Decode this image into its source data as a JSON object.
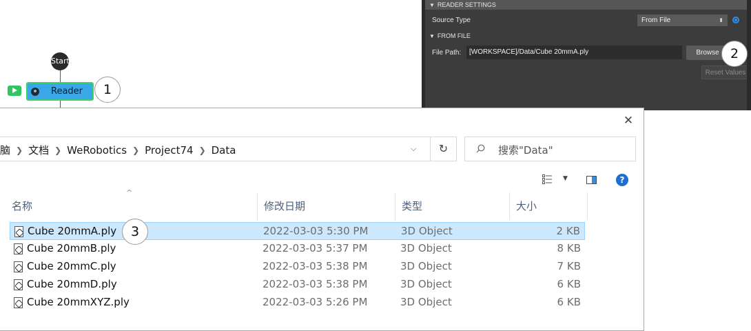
{
  "flow": {
    "start_label": "Start",
    "reader_label": "Reader"
  },
  "callouts": [
    "1",
    "2",
    "3"
  ],
  "panel": {
    "reader_settings_header": "READER SETTINGS",
    "source_type_label": "Source Type",
    "source_type_value": "From File",
    "from_file_header": "FROM FILE",
    "file_path_label": "File Path:",
    "file_path_value": "[WORKSPACE]/Data/Cube 20mmA.ply",
    "browse_label": "Browse",
    "reset_label": "Reset Values"
  },
  "dialog": {
    "breadcrumb": [
      "电脑",
      "文档",
      "WeRobotics",
      "Project74",
      "Data"
    ],
    "search_placeholder": "搜索\"Data\"",
    "columns": {
      "name": "名称",
      "date": "修改日期",
      "type": "类型",
      "size": "大小"
    },
    "files": [
      {
        "name": "Cube 20mmA.ply",
        "date": "2022-03-03 5:30 PM",
        "type": "3D Object",
        "size": "2 KB",
        "selected": true
      },
      {
        "name": "Cube 20mmB.ply",
        "date": "2022-03-03 5:37 PM",
        "type": "3D Object",
        "size": "8 KB",
        "selected": false
      },
      {
        "name": "Cube 20mmC.ply",
        "date": "2022-03-03 5:38 PM",
        "type": "3D Object",
        "size": "7 KB",
        "selected": false
      },
      {
        "name": "Cube 20mmD.ply",
        "date": "2022-03-03 5:38 PM",
        "type": "3D Object",
        "size": "6 KB",
        "selected": false
      },
      {
        "name": "Cube 20mmXYZ.ply",
        "date": "2022-03-03 5:26 PM",
        "type": "3D Object",
        "size": "6 KB",
        "selected": false
      }
    ]
  },
  "colors": {
    "reader_node_fill": "#3aa8e6",
    "reader_node_border": "#3bd16f",
    "selection_fill": "#cce8ff",
    "panel_bg": "#3c3c3c",
    "accent_blue": "#2c8ee8"
  }
}
